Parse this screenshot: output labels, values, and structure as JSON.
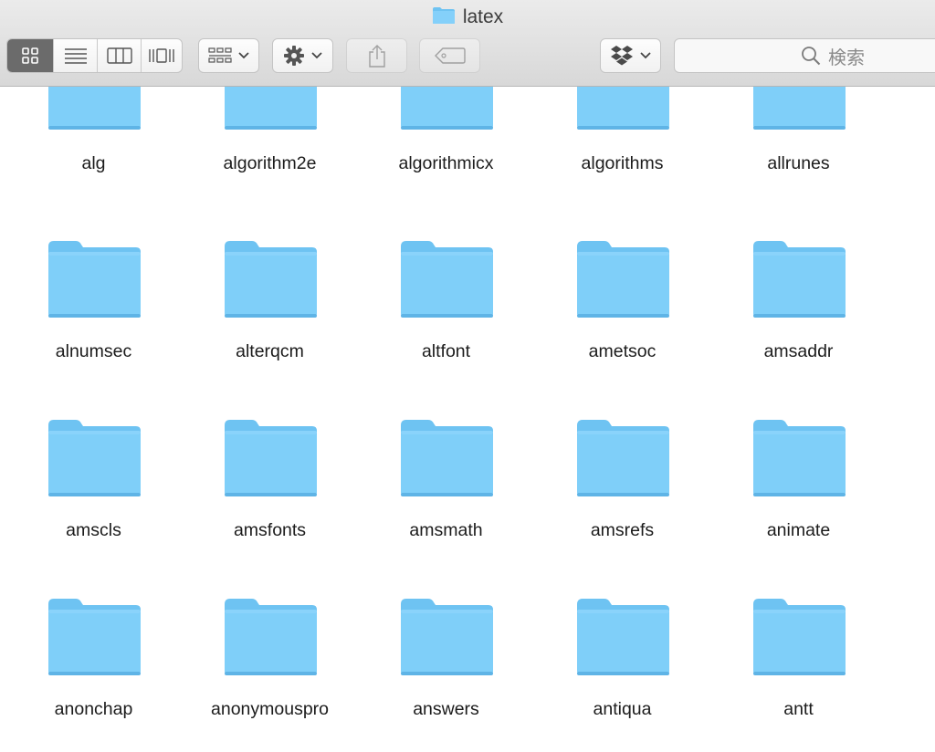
{
  "window": {
    "title": "latex"
  },
  "toolbar": {
    "view_modes": [
      "icon-view",
      "list-view",
      "column-view",
      "cover-flow-view"
    ],
    "active_view": "icon-view",
    "search_placeholder": "検索"
  },
  "colors": {
    "folder_top": "#8ad3fb",
    "folder_body": "#7fcff9",
    "folder_tab": "#6ec3f2",
    "folder_bottom": "#5fb4e6",
    "toolbar_bg": "#e3e3e3",
    "active_segment": "#6b6b6b"
  },
  "folders": [
    {
      "name": "alg"
    },
    {
      "name": "algorithm2e"
    },
    {
      "name": "algorithmicx"
    },
    {
      "name": "algorithms"
    },
    {
      "name": "allrunes"
    },
    {
      "name": "alnumsec"
    },
    {
      "name": "alterqcm"
    },
    {
      "name": "altfont"
    },
    {
      "name": "ametsoc"
    },
    {
      "name": "amsaddr"
    },
    {
      "name": "amscls"
    },
    {
      "name": "amsfonts"
    },
    {
      "name": "amsmath"
    },
    {
      "name": "amsrefs"
    },
    {
      "name": "animate"
    },
    {
      "name": "anonchap"
    },
    {
      "name": "anonymouspro"
    },
    {
      "name": "answers"
    },
    {
      "name": "antiqua"
    },
    {
      "name": "antt"
    }
  ]
}
